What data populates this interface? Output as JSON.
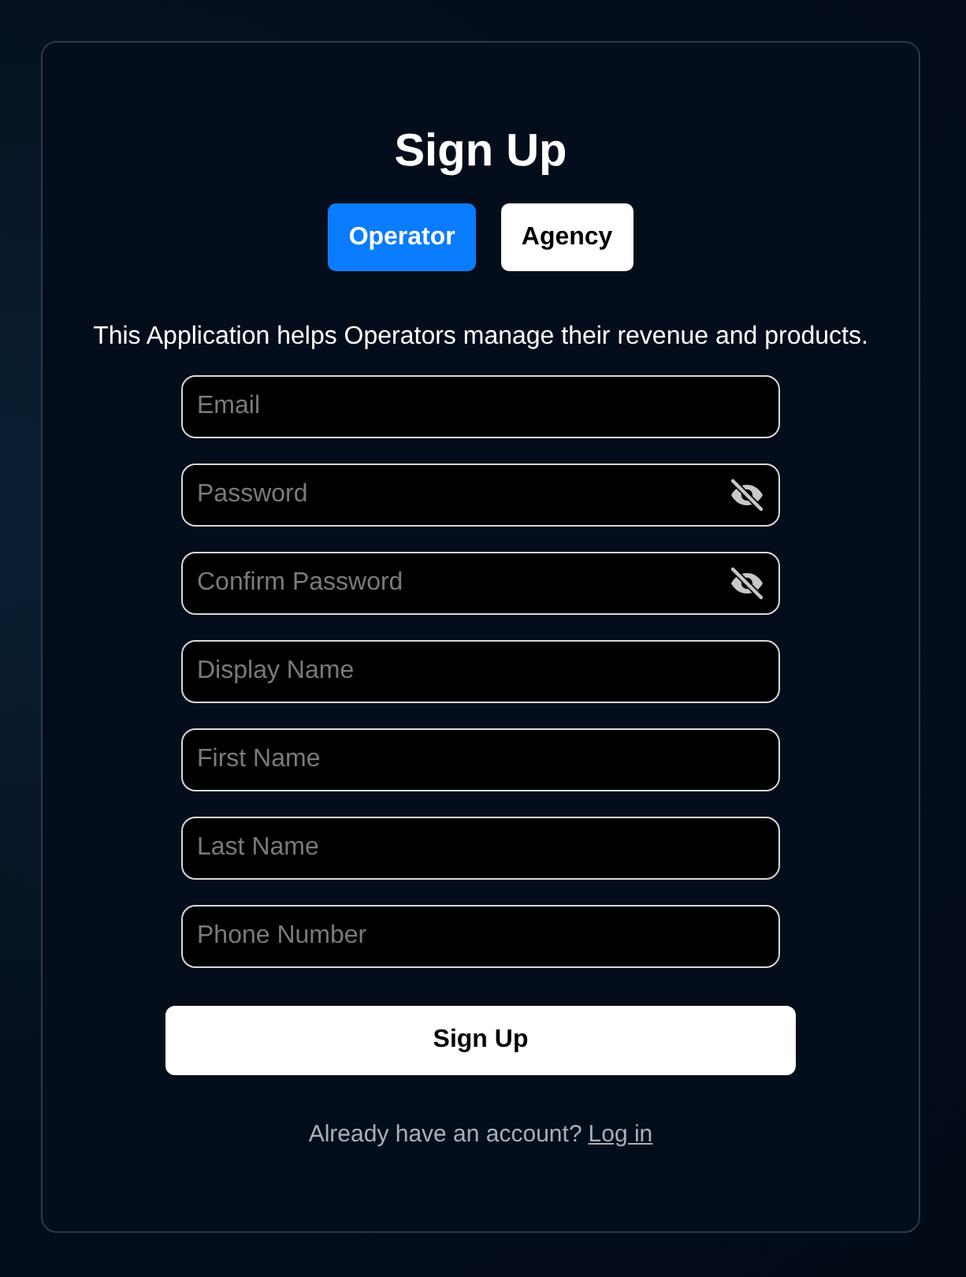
{
  "title": "Sign Up",
  "tabs": [
    {
      "label": "Operator",
      "selected": true
    },
    {
      "label": "Agency",
      "selected": false
    }
  ],
  "description": "This Application helps Operators manage their revenue and products.",
  "fields": [
    {
      "kind": "text",
      "placeholder": "Email"
    },
    {
      "kind": "password",
      "placeholder": "Password"
    },
    {
      "kind": "password",
      "placeholder": "Confirm Password"
    },
    {
      "kind": "text",
      "placeholder": "Display Name"
    },
    {
      "kind": "text",
      "placeholder": "First Name"
    },
    {
      "kind": "text",
      "placeholder": "Last Name"
    },
    {
      "kind": "text",
      "placeholder": "Phone Number"
    }
  ],
  "submit": "Sign Up",
  "footer": {
    "text": "Already have an account?",
    "link": "Log in"
  }
}
